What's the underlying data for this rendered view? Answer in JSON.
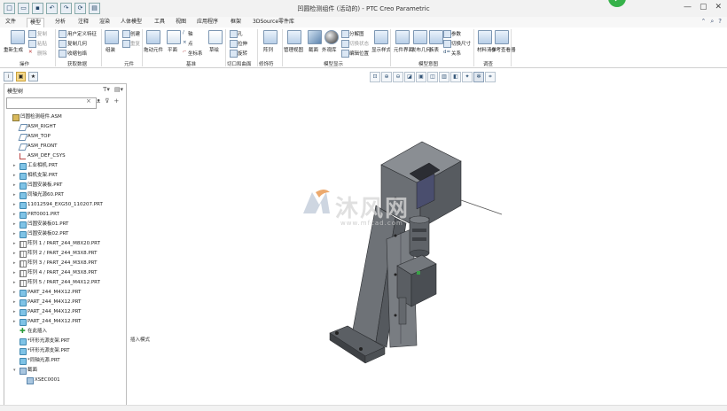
{
  "window": {
    "title": "凹圆检测组件 (活动的) - PTC Creo Parametric",
    "quick_access": [
      "新建",
      "打开",
      "保存",
      "撤销",
      "重做",
      "再生",
      "窗口"
    ]
  },
  "menu": {
    "tabs": [
      "文件",
      "模型",
      "分析",
      "注释",
      "渲染",
      "人体模型",
      "工具",
      "视图",
      "应用程序",
      "框架",
      "3DSource零件库"
    ],
    "active_tab": "模型"
  },
  "ribbon": {
    "operations": {
      "regen_label": "重新生成",
      "copy": "复制",
      "paste": "粘贴",
      "delete": "删除",
      "group_label": "操作"
    },
    "get_data": {
      "udf": "用户定义特征",
      "copy_geom": "复制几何",
      "shrinkwrap": "收缩包络",
      "group_label": "获取数据"
    },
    "components": {
      "assemble": "组装",
      "create": "创建",
      "repeat": "重复",
      "group_label": "元件"
    },
    "datum": {
      "drag_label": "拖动元件",
      "plane": "平面",
      "axis": "轴",
      "point": "点",
      "csys": "坐标系",
      "sketch": "草绘",
      "group_label": "基准"
    },
    "cut_surface": {
      "hole": "孔",
      "extrude": "拉伸",
      "revolve": "旋转",
      "group_label": "切口和曲面"
    },
    "modifiers": {
      "pattern": "阵列",
      "group_label": "修饰符"
    },
    "model_display": {
      "manage_views": "管理视图",
      "section": "截面",
      "appearance": "外观库",
      "explode": "分解图",
      "toggle_status": "切换状态",
      "edit_position": "编辑位置",
      "display_style": "显示样式",
      "group_label": "模型显示"
    },
    "model_intent": {
      "publish_geom": "发布几何",
      "component_interface": "元件界面",
      "params": "参数",
      "switch_dims": "切换尺寸",
      "relations": "关系",
      "family_table": "族表",
      "group_label": "模型意图"
    },
    "investigate": {
      "bom": "材料清单",
      "reference_viewer": "参考查看器",
      "group_label": "调查"
    }
  },
  "model_tree": {
    "header": "模型树",
    "search_placeholder": "",
    "items": [
      {
        "label": "凹圆检测组件.ASM",
        "icon": "assembly-icon",
        "level": 0,
        "expand": ""
      },
      {
        "label": "ASM_RIGHT",
        "icon": "datum-plane-icon",
        "level": 1,
        "expand": ""
      },
      {
        "label": "ASM_TOP",
        "icon": "datum-plane-icon",
        "level": 1,
        "expand": ""
      },
      {
        "label": "ASM_FRONT",
        "icon": "datum-plane-icon",
        "level": 1,
        "expand": ""
      },
      {
        "label": "ASM_DEF_CSYS",
        "icon": "csys-icon",
        "level": 1,
        "expand": ""
      },
      {
        "label": "工业相机.PRT",
        "icon": "part-icon",
        "level": 1,
        "expand": "▸"
      },
      {
        "label": "相机支架.PRT",
        "icon": "part-icon",
        "level": 1,
        "expand": "▸"
      },
      {
        "label": "凹圆安装板.PRT",
        "icon": "part-icon",
        "level": 1,
        "expand": "▸"
      },
      {
        "label": "同轴光源60.PRT",
        "icon": "part-icon",
        "level": 1,
        "expand": "▸"
      },
      {
        "label": "11012594_EXG50_110207.PRT",
        "icon": "part-icon",
        "level": 1,
        "expand": "▸"
      },
      {
        "label": "PRT0001.PRT",
        "icon": "part-icon",
        "level": 1,
        "expand": "▸"
      },
      {
        "label": "凹圆安装板01.PRT",
        "icon": "part-icon",
        "level": 1,
        "expand": "▸"
      },
      {
        "label": "凹圆安装板02.PRT",
        "icon": "part-icon",
        "level": 1,
        "expand": "▸"
      },
      {
        "label": "阵列 1 / PART_244_M8X20.PRT",
        "icon": "pattern-icon",
        "level": 1,
        "expand": "▸"
      },
      {
        "label": "阵列 2 / PART_244_M3X8.PRT",
        "icon": "pattern-icon",
        "level": 1,
        "expand": "▸"
      },
      {
        "label": "阵列 3 / PART_244_M3X8.PRT",
        "icon": "pattern-icon",
        "level": 1,
        "expand": "▸"
      },
      {
        "label": "阵列 4 / PART_244_M3X8.PRT",
        "icon": "pattern-icon",
        "level": 1,
        "expand": "▸"
      },
      {
        "label": "阵列 5 / PART_244_M4X12.PRT",
        "icon": "pattern-icon",
        "level": 1,
        "expand": "▸"
      },
      {
        "label": "PART_244_M4X12.PRT",
        "icon": "part-icon",
        "level": 1,
        "expand": "▸"
      },
      {
        "label": "PART_244_M4X12.PRT",
        "icon": "part-icon",
        "level": 1,
        "expand": "▸"
      },
      {
        "label": "PART_244_M4X12.PRT",
        "icon": "part-icon",
        "level": 1,
        "expand": "▸"
      },
      {
        "label": "PART_244_M4X12.PRT",
        "icon": "part-icon",
        "level": 1,
        "expand": "▸"
      },
      {
        "label": "在此插入",
        "icon": "insert-here-icon",
        "level": 1,
        "expand": ""
      },
      {
        "label": "*环形光源支架.PRT",
        "icon": "part-icon",
        "level": 1,
        "expand": ""
      },
      {
        "label": "*环形光源支架.PRT",
        "icon": "part-icon",
        "level": 1,
        "expand": ""
      },
      {
        "label": "*同轴光源.PRT",
        "icon": "part-icon",
        "level": 1,
        "expand": ""
      },
      {
        "label": "截面",
        "icon": "section-folder-icon",
        "level": 1,
        "expand": "▾"
      },
      {
        "label": "XSEC0001",
        "icon": "section-icon",
        "level": 2,
        "expand": ""
      }
    ]
  },
  "viewport": {
    "mode_label": "插入模式",
    "toolbar_icons": [
      "refit-icon",
      "zoom-in-icon",
      "zoom-out-icon",
      "repaint-icon",
      "display-style-icon",
      "saved-views-icon",
      "view-manager-icon",
      "section-view-icon",
      "datum-display-icon",
      "spin-center-icon",
      "annotation-display-icon"
    ]
  },
  "watermark": {
    "brand": "沐风网",
    "url": "www.mfcad.com"
  },
  "colors": {
    "accent_green": "#36b24a",
    "part_gray": "#6f7378",
    "ribbon_blue": "#7d97b3"
  }
}
